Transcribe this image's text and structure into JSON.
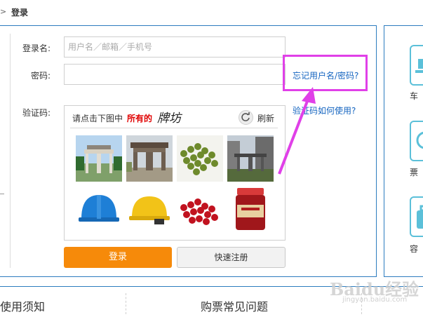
{
  "breadcrumb": {
    "sep": ">",
    "current": "登录"
  },
  "form": {
    "username_label": "登录名:",
    "username_placeholder": "用户名／邮箱／手机号",
    "password_label": "密码:",
    "captcha_label": "验证码:",
    "forgot_link": "忘记用户名/密码?",
    "captcha_help_link": "验证码如何使用?"
  },
  "captcha": {
    "instruction": "请点击下图中",
    "keyword": "所有的",
    "target": "牌坊",
    "refresh_label": "刷新",
    "tiles": [
      {
        "subject": "paifang-archway-trees"
      },
      {
        "subject": "paifang-archway-old"
      },
      {
        "subject": "green-beans"
      },
      {
        "subject": "paifang-archway-modern"
      },
      {
        "subject": "blue-hardhat"
      },
      {
        "subject": "yellow-hardhat"
      },
      {
        "subject": "red-beans"
      },
      {
        "subject": "chili-jar"
      }
    ]
  },
  "buttons": {
    "login": "登录",
    "register": "快速注册"
  },
  "side_panel": {
    "items": [
      {
        "label": "车",
        "icon": "train-icon"
      },
      {
        "label": "票",
        "icon": "clock-icon"
      },
      {
        "label": "容",
        "icon": "bag-icon"
      }
    ]
  },
  "footer": {
    "left": "使用须知",
    "middle": "购票常见问题"
  },
  "watermark": {
    "text": "Baidu经验",
    "sub": "jingyan.baidu.com"
  },
  "colors": {
    "accent_blue": "#2d7cbf",
    "login_orange": "#f68a0a",
    "highlight_magenta": "#e040e8",
    "link_blue": "#1565c0"
  }
}
